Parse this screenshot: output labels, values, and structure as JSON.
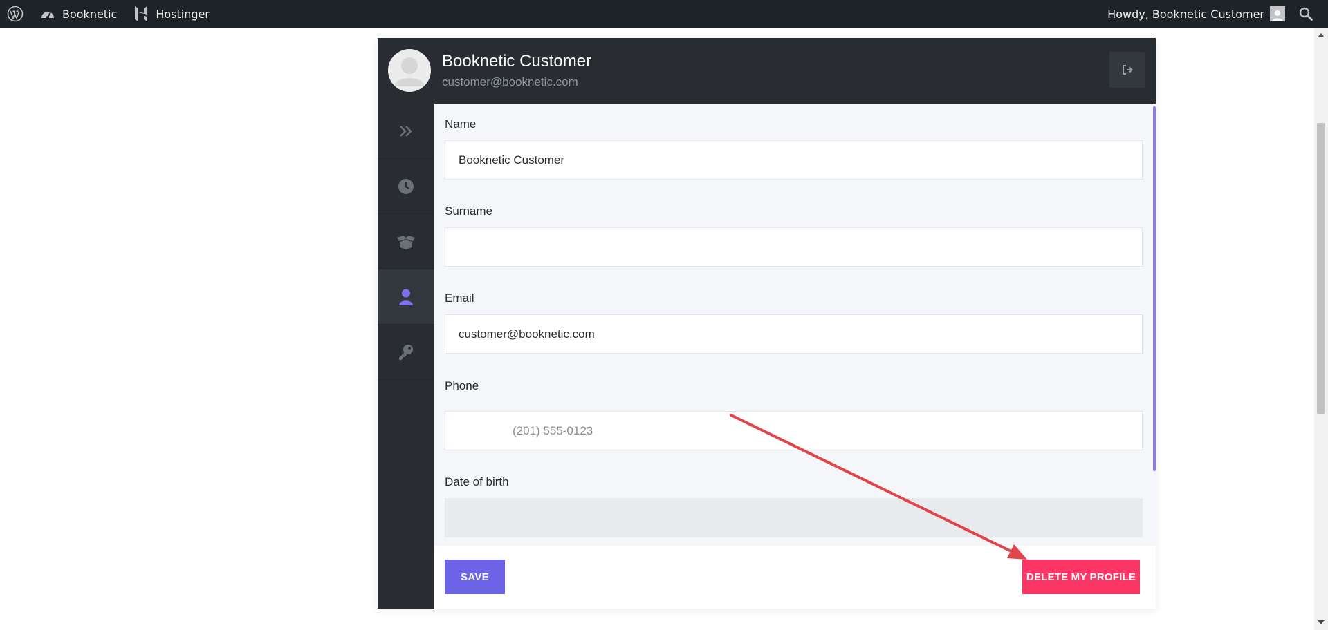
{
  "adminbar": {
    "wp_icon": "wordpress-logo-icon",
    "items": [
      {
        "icon": "dashboard-gauge-icon",
        "label": "Booknetic"
      },
      {
        "icon": "hostinger-logo-icon",
        "label": "Hostinger"
      }
    ],
    "greeting": "Howdy, Booknetic Customer",
    "search_icon": "search-icon"
  },
  "profile": {
    "name": "Booknetic Customer",
    "email": "customer@booknetic.com"
  },
  "sidebar": {
    "items": [
      {
        "icon": "double-chevron-right-icon",
        "active": false
      },
      {
        "icon": "clock-icon",
        "active": false
      },
      {
        "icon": "box-open-icon",
        "active": false
      },
      {
        "icon": "user-icon",
        "active": true
      },
      {
        "icon": "key-icon",
        "active": false
      }
    ]
  },
  "form": {
    "name_label": "Name",
    "name_value": "Booknetic Customer",
    "surname_label": "Surname",
    "surname_value": "",
    "email_label": "Email",
    "email_value": "customer@booknetic.com",
    "phone_label": "Phone",
    "phone_placeholder": "(201) 555-0123",
    "dob_label": "Date of birth",
    "dob_value": ""
  },
  "actions": {
    "save_label": "SAVE",
    "delete_label": "DELETE MY PROFILE"
  },
  "colors": {
    "primary": "#6c63e6",
    "danger": "#fb3665",
    "dark": "#292d32",
    "annotation_arrow": "#e0454a"
  }
}
